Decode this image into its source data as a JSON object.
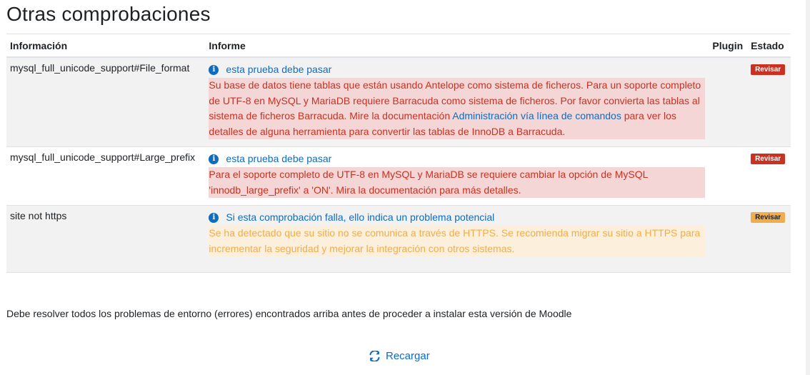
{
  "page": {
    "title": "Otras comprobaciones"
  },
  "table": {
    "headers": {
      "info": "Información",
      "report": "Informe",
      "plugin": "Plugin",
      "status": "Estado"
    },
    "rows": [
      {
        "info": "mysql_full_unicode_support#File_format",
        "link": "esta prueba debe pasar",
        "message_before": "Su base de datos tiene tablas que están usando Antelope como sistema de ficheros. Para un soporte completo de UTF-8 en MySQL y MariaDB requiere Barracuda como sistema de ficheros. Por favor convierta las tablas al sistema de ficheros Barracuda. Mire la documentación ",
        "message_link": "Administración vía línea de comandos",
        "message_after": " para ver los detalles de alguna herramienta para convertir las tablas de InnoDB a Barracuda.",
        "status": "Revisar"
      },
      {
        "info": "mysql_full_unicode_support#Large_prefix",
        "link": "esta prueba debe pasar",
        "message": "Para el soporte completo de UTF-8 en MySQL y MariaDB se requiere cambiar la opción de MySQL 'innodb_large_prefix' a 'ON'. Mira la documentación para más detalles.",
        "status": "Revisar"
      },
      {
        "info": "site not https",
        "link": "Si esta comprobación falla, ello indica un problema potencial",
        "message": "Se ha detectado que su sitio no se comunica a través de HTTPS. Se recomienda migrar su sitio a HTTPS para incrementar la seguridad y mejorar la integración con otros sistemas.",
        "status": "Revisar"
      }
    ]
  },
  "footer": {
    "note": "Debe resolver todos los problemas de entorno (errores) encontrados arriba antes de proceder a instalar esta versión de Moodle",
    "reload_label": "Recargar"
  },
  "icons": {
    "info": "info-circle-icon",
    "reload": "refresh-icon"
  },
  "colors": {
    "link": "#0f6cbf",
    "danger": "#ca3120",
    "danger_bg": "#f4d6d6",
    "warning": "#f0ad4e",
    "warning_bg": "#fcefdc"
  }
}
